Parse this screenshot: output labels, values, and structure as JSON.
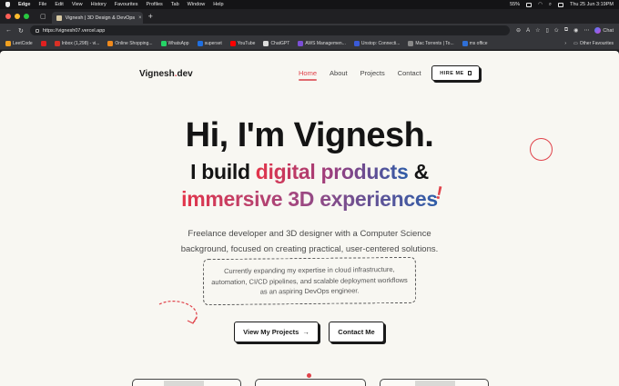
{
  "menubar": {
    "app": "Edge",
    "items": [
      "File",
      "Edit",
      "View",
      "History",
      "Favourites",
      "Profiles",
      "Tab",
      "Window",
      "Help"
    ],
    "battery": "55%",
    "clock": "Thu 25 Jun  3:19PM"
  },
  "tab": {
    "title": "Vignesh | 3D Design & DevOps"
  },
  "toolbar": {
    "url": "https://vignesh07.vercel.app",
    "chat_label": "Chat"
  },
  "bookmarks": {
    "items": [
      {
        "label": "LeetCode",
        "color": "#f0a020"
      },
      {
        "label": "",
        "color": "#e02020"
      },
      {
        "label": "Inbox (1,298) - vi...",
        "color": "#d93025"
      },
      {
        "label": "Online Shopping...",
        "color": "#f08a1d"
      },
      {
        "label": "WhatsApp",
        "color": "#25d366"
      },
      {
        "label": "superset",
        "color": "#1f6fe0"
      },
      {
        "label": "YouTube",
        "color": "#ff0000"
      },
      {
        "label": "ChatGPT",
        "color": "#dddddd"
      },
      {
        "label": "AWS Managemen...",
        "color": "#7b4fd6"
      },
      {
        "label": "Unstop: Connecti...",
        "color": "#3a5bd9"
      },
      {
        "label": "Mac Torrents | To...",
        "color": "#888888"
      },
      {
        "label": "ms office",
        "color": "#2f6fd6"
      }
    ],
    "other": "Other Favourites"
  },
  "site": {
    "logo_main": "Vignesh",
    "logo_dot": ".",
    "logo_tail": "dev",
    "nav": [
      "Home",
      "About",
      "Projects",
      "Contact"
    ],
    "hire_label": "HIRE ME",
    "headline": "Hi, I'm Vignesh.",
    "line2_pre": "I build ",
    "line2_grad": "digital products",
    "line2_post": " &",
    "line3": "immersive 3D experiences",
    "excl": "!",
    "sub_line1": "Freelance developer and 3D designer with a Computer Science",
    "sub_line2": "background, focused on creating practical, user-centered solutions.",
    "note": "Currently expanding my expertise in cloud infrastructure, automation, CI/CD pipelines, and scalable deployment workflows as an aspiring DevOps engineer.",
    "btn_projects": "View My Projects",
    "btn_projects_arrow": "→",
    "btn_contact": "Contact Me"
  },
  "colors": {
    "accent": "#e0424a",
    "blue": "#2e5da8",
    "ink": "#141414",
    "paper": "#f8f7f2"
  }
}
